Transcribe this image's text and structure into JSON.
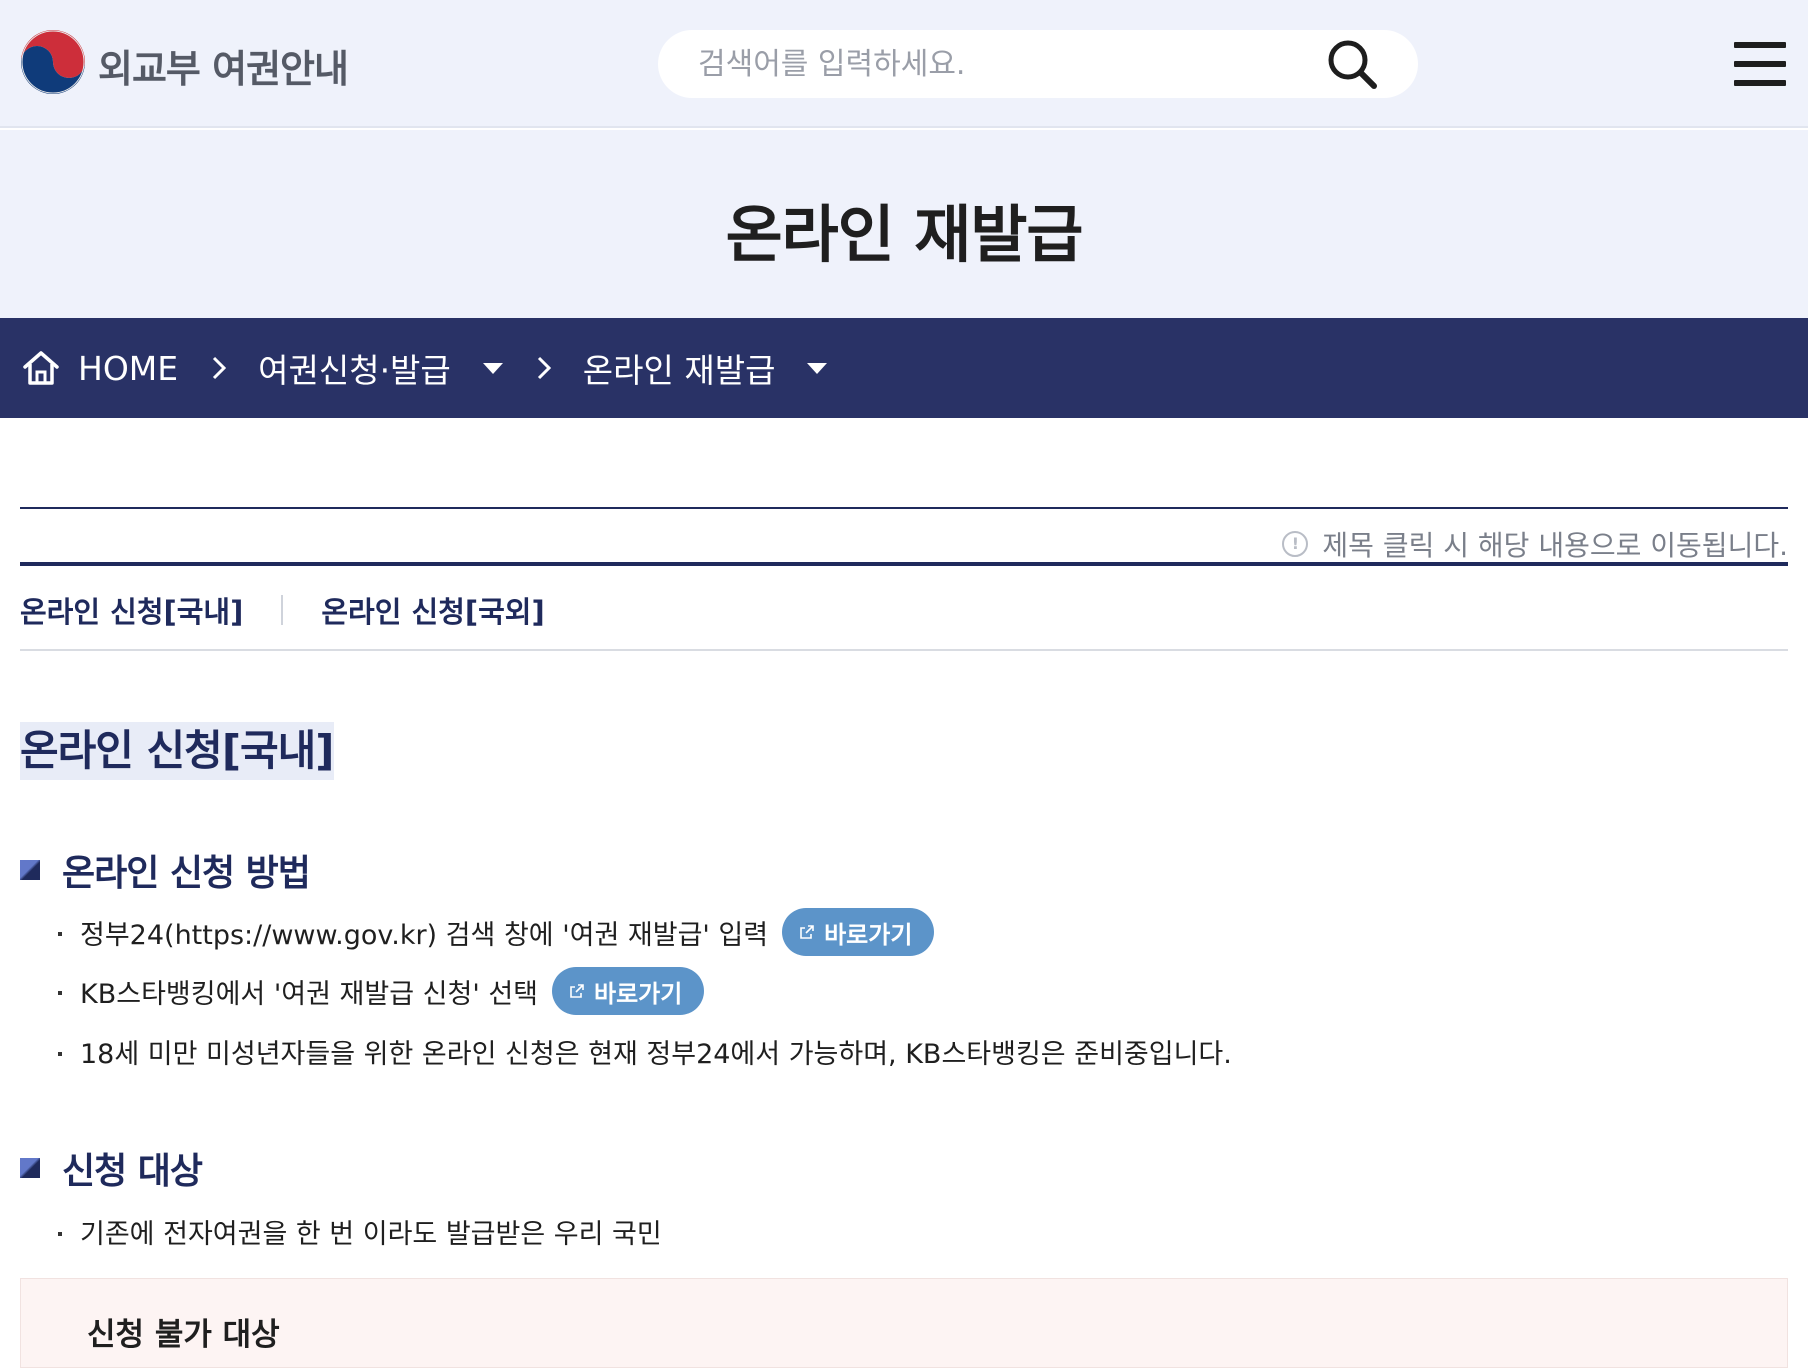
{
  "header": {
    "logo_text": "외교부 여권안내",
    "search_placeholder": "검색어를 입력하세요."
  },
  "page_title": "온라인 재발급",
  "breadcrumb": {
    "home": "HOME",
    "level1": "여권신청·발급",
    "level2": "온라인 재발급"
  },
  "toc": {
    "notice": "제목 클릭 시 해당 내용으로 이동됩니다.",
    "links": [
      "온라인 신청[국내]",
      "온라인 신청[국외]"
    ]
  },
  "section": {
    "title": "온라인 신청[국내]",
    "method": {
      "heading": "온라인 신청 방법",
      "items": [
        "정부24(https://www.gov.kr) 검색 창에 '여권 재발급' 입력",
        "KB스타뱅킹에서 '여권 재발급 신청' 선택",
        "18세 미만 미성년자들을 위한 온라인 신청은 현재 정부24에서 가능하며, KB스타뱅킹은 준비중입니다."
      ],
      "go_label": "바로가기"
    },
    "target": {
      "heading": "신청 대상",
      "items": [
        "기존에 전자여권을 한 번 이라도 발급받은 우리 국민"
      ]
    },
    "excluded": {
      "heading": "신청 불가 대상"
    }
  },
  "colors": {
    "navy": "#293266",
    "header_bg": "#eff2fb",
    "button_blue": "#5c94c9"
  },
  "icons": [
    "logo-emblem-icon",
    "search-icon",
    "hamburger-menu-icon",
    "home-icon",
    "chevron-right-icon",
    "caret-down-icon",
    "info-icon",
    "external-link-icon"
  ]
}
